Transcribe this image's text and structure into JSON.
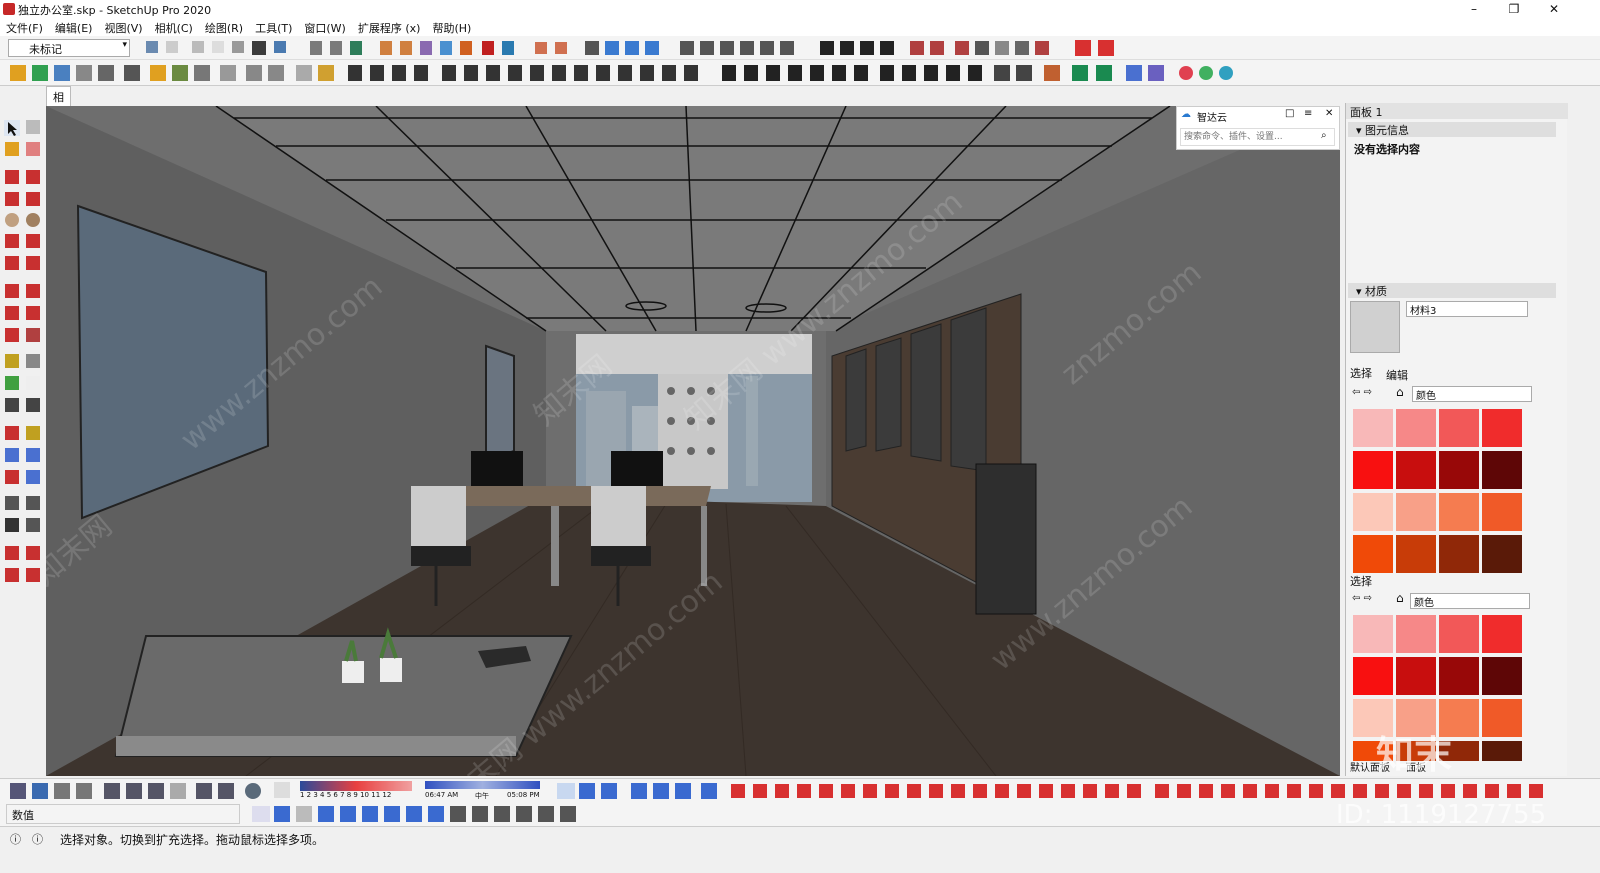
{
  "window": {
    "title": "独立办公室.skp - SketchUp Pro 2020",
    "minimize": "–",
    "restore": "❐",
    "close": "✕"
  },
  "menu": [
    "文件(F)",
    "编辑(E)",
    "视图(V)",
    "相机(C)",
    "绘图(R)",
    "工具(T)",
    "窗口(W)",
    "扩展程序 (x)",
    "帮助(H)"
  ],
  "toolbar": {
    "tag_value": "未标记",
    "tag_check": "✓",
    "dropdown_arrow": "▾"
  },
  "scene_tab": "相机归位",
  "search_panel": {
    "title": "智达云",
    "placeholder": "搜索命令、插件、设置..."
  },
  "right_panel": {
    "title": "面板 1",
    "entity_info_header": "图元信息",
    "entity_info_text": "没有选择内容",
    "materials_header": "材质",
    "material_name": "材料3",
    "select_tab": "选择",
    "edit_tab": "编辑",
    "collection": "颜色",
    "select_label2": "选择",
    "collection2": "颜色",
    "bottom_tab1": "默认面板",
    "bottom_tab2": "面板"
  },
  "colors": {
    "swatches": [
      "#f8b8b8",
      "#f68888",
      "#f25858",
      "#f02c2c",
      "#f81010",
      "#c80e0e",
      "#980808",
      "#5e0606",
      "#fcc8b8",
      "#f8a088",
      "#f57c50",
      "#f05a28",
      "#f04a08",
      "#c83c08",
      "#902808",
      "#5a1a08"
    ]
  },
  "measurements": {
    "label": "数值"
  },
  "shadow": {
    "months": "1 2 3 4 5 6 7 8 9 10 11 12",
    "time_start": "06:47 AM",
    "noon": "中午",
    "time_end": "05:08 PM"
  },
  "status": {
    "message": "选择对象。切换到扩充选择。拖动鼠标选择多项。"
  },
  "overlay": {
    "brand": "知末",
    "id_label": "ID: 1119127755",
    "watermarks": [
      "www.znzmo.com",
      "知末网",
      "知末网 www.znzmo.com",
      "znzmo.com",
      "www.znzmo.com",
      "知末网 www.znzmo.com",
      "知末网"
    ]
  }
}
